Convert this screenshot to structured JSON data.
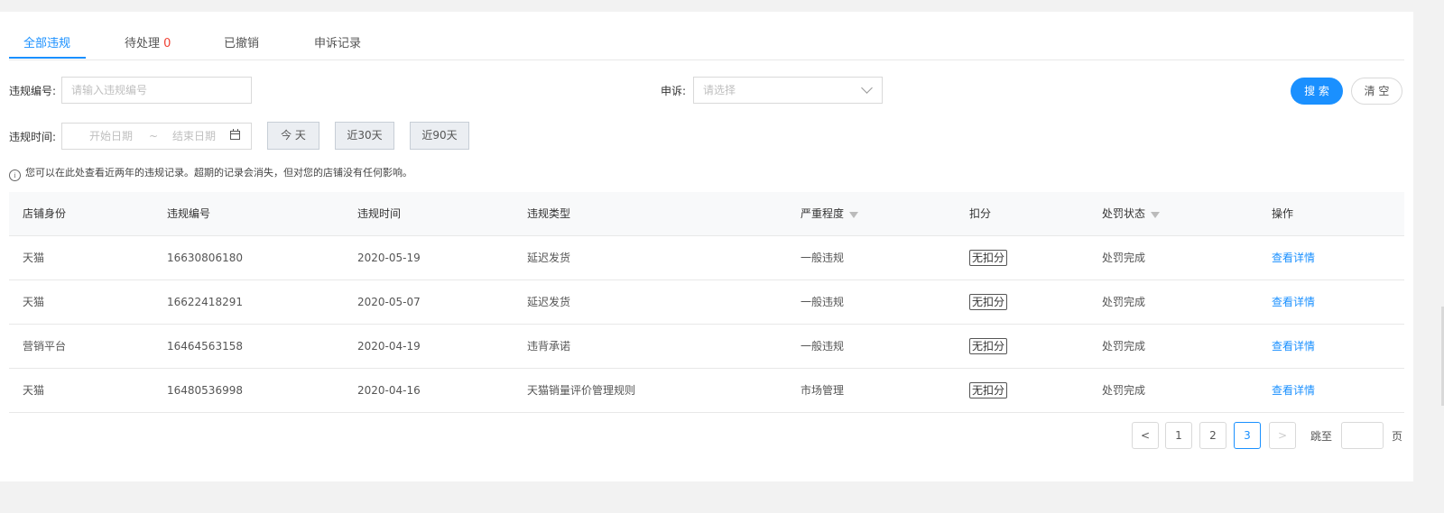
{
  "tabs": [
    {
      "label": "全部违规",
      "active": true
    },
    {
      "label": "待处理",
      "count": "0"
    },
    {
      "label": "已撤销"
    },
    {
      "label": "申诉记录"
    }
  ],
  "filters": {
    "violation_no_label": "违规编号:",
    "violation_no_placeholder": "请输入违规编号",
    "appeal_label": "申诉:",
    "appeal_placeholder": "请选择",
    "time_label": "违规时间:",
    "start_placeholder": "开始日期",
    "range_sep": "~",
    "end_placeholder": "结束日期",
    "quick": [
      "今 天",
      "近30天",
      "近90天"
    ],
    "search_label": "搜 索",
    "clear_label": "清 空"
  },
  "notice": "您可以在此处查看近两年的违规记录。超期的记录会消失，但对您的店铺没有任何影响。",
  "table": {
    "columns": [
      "店铺身份",
      "违规编号",
      "违规时间",
      "违规类型",
      "严重程度",
      "扣分",
      "处罚状态",
      "操作"
    ],
    "rows": [
      {
        "identity": "天猫",
        "no": "16630806180",
        "time": "2020-05-19",
        "type": "延迟发货",
        "severity": "一般违规",
        "points": "无扣分",
        "status": "处罚完成",
        "action": "查看详情"
      },
      {
        "identity": "天猫",
        "no": "16622418291",
        "time": "2020-05-07",
        "type": "延迟发货",
        "severity": "一般违规",
        "points": "无扣分",
        "status": "处罚完成",
        "action": "查看详情"
      },
      {
        "identity": "营销平台",
        "no": "16464563158",
        "time": "2020-04-19",
        "type": "违背承诺",
        "severity": "一般违规",
        "points": "无扣分",
        "status": "处罚完成",
        "action": "查看详情"
      },
      {
        "identity": "天猫",
        "no": "16480536998",
        "time": "2020-04-16",
        "type": "天猫销量评价管理规则",
        "severity": "市场管理",
        "points": "无扣分",
        "status": "处罚完成",
        "action": "查看详情"
      }
    ]
  },
  "pagination": {
    "prev": "<",
    "pages": [
      "1",
      "2",
      "3"
    ],
    "current": "3",
    "next": ">",
    "jump_label": "跳至",
    "page_suffix": "页"
  },
  "colors": {
    "accent": "#1a90ff",
    "count_red": "#f04134"
  }
}
